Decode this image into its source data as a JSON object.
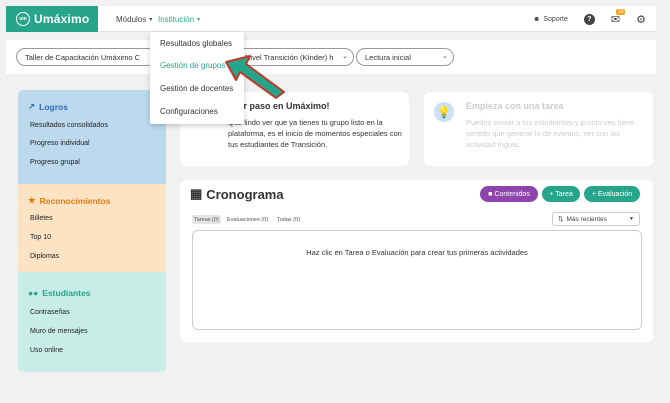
{
  "header": {
    "brand": "Umáximo",
    "brand_logo": "um",
    "nav": {
      "modulos": "Módulos",
      "institucion": "Institución"
    },
    "soporte": "Soporte",
    "help_icon": "?",
    "notification_count": "10"
  },
  "filters": {
    "taller": "Taller de Capacitación Umáximo C",
    "nivel": "Nivel Transición (Kínder) h",
    "lectura": "Lectura inicial"
  },
  "dropdown": {
    "items": [
      "Resultados globales",
      "Gestión de grupos",
      "Gestión de docentes",
      "Configuraciones"
    ],
    "highlighted": "Gestión de grupos"
  },
  "sidebar": {
    "logros": {
      "title": "Logros",
      "items": [
        "Resultados consolidados",
        "Progreso individual",
        "Progreso grupal"
      ]
    },
    "reconocimientos": {
      "title": "Reconocimientos",
      "items": [
        "Billetes",
        "Top 10",
        "Diplomas"
      ]
    },
    "estudiantes": {
      "title": "Estudiantes",
      "items": [
        "Contraseñas",
        "Muro de mensajes",
        "Uso online"
      ]
    }
  },
  "welcome": {
    "title": "imer paso en Umáximo!",
    "text": "Qué lindo ver que ya tienes tu grupo listo en la plataforma, es el inicio de momentos especiales con tus estudiantes de Transición."
  },
  "tasks_card": {
    "title": "Empieza con una tarea",
    "text": "Puedes enviar a tus estudiantes y pronto ves tiene sentido que generar lo de eventos, ver con las actividad Ingres."
  },
  "cronograma": {
    "title": "Cronograma",
    "buttons": {
      "contenidos": "Contenidos",
      "tarea": "Tarea",
      "evaluacion": "Evaluación"
    },
    "tabs": [
      "Tareas (0)",
      "Evaluaciones (0)",
      "Todas (0)"
    ],
    "sort": "Más recientes",
    "empty": "Haz clic en Tarea o Evaluación para crear tus primeras actividades"
  },
  "colors": {
    "brand": "#27a58a",
    "logros": "#bcd9ee",
    "reconocimientos": "#fbe3c4",
    "estudiantes": "#c8ece6",
    "contenidos": "#8e44ad",
    "arrow": "#27a58a"
  }
}
